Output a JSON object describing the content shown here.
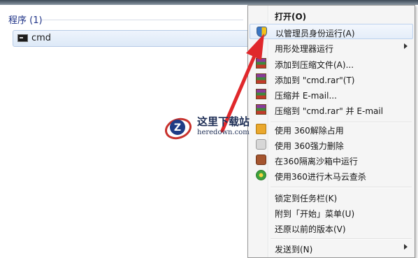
{
  "search_results": {
    "section_header": "程序 (1)",
    "items": [
      {
        "label": "cmd",
        "icon": "cmd-icon"
      }
    ]
  },
  "context_menu": {
    "items": [
      {
        "id": "open",
        "label": "打开(O)",
        "icon": null,
        "bold": true
      },
      {
        "id": "run-as-admin",
        "label": "以管理员身份运行(A)",
        "icon": "uac-shield-icon",
        "highlighted": true
      },
      {
        "id": "run-with-gpu",
        "label": "用形处理器运行",
        "icon": null,
        "submenu": true
      },
      {
        "id": "add-to-archive",
        "label": "添加到压缩文件(A)...",
        "icon": "winrar-icon"
      },
      {
        "id": "add-to-cmd-rar",
        "label": "添加到 \"cmd.rar\"(T)",
        "icon": "winrar-icon"
      },
      {
        "id": "compress-email",
        "label": "压缩并 E-mail...",
        "icon": "winrar-icon"
      },
      {
        "id": "compress-rar-email",
        "label": "压缩到 \"cmd.rar\" 并 E-mail",
        "icon": "winrar-icon"
      },
      {
        "id": "360-unlock",
        "label": "使用 360解除占用",
        "icon": "360-unlock-icon"
      },
      {
        "id": "360-force-delete",
        "label": "使用 360强力删除",
        "icon": "360-delete-icon"
      },
      {
        "id": "360-sandbox",
        "label": "在360隔离沙箱中运行",
        "icon": "360-sandbox-icon"
      },
      {
        "id": "360-trojan-scan",
        "label": "使用360进行木马云查杀",
        "icon": "360-scan-icon"
      },
      {
        "id": "pin-taskbar",
        "label": "锁定到任务栏(K)",
        "icon": null
      },
      {
        "id": "pin-start",
        "label": "附到「开始」菜单(U)",
        "icon": null
      },
      {
        "id": "restore-previous",
        "label": "还原以前的版本(V)",
        "icon": null
      },
      {
        "id": "send-to",
        "label": "发送到(N)",
        "icon": null,
        "submenu": true
      }
    ]
  },
  "watermark": {
    "title": "这里下载站",
    "url": "heredown.com"
  },
  "colors": {
    "header_blue": "#1e3287",
    "arrow_red": "#e0282b",
    "menu_bg": "#f5f5f5"
  }
}
